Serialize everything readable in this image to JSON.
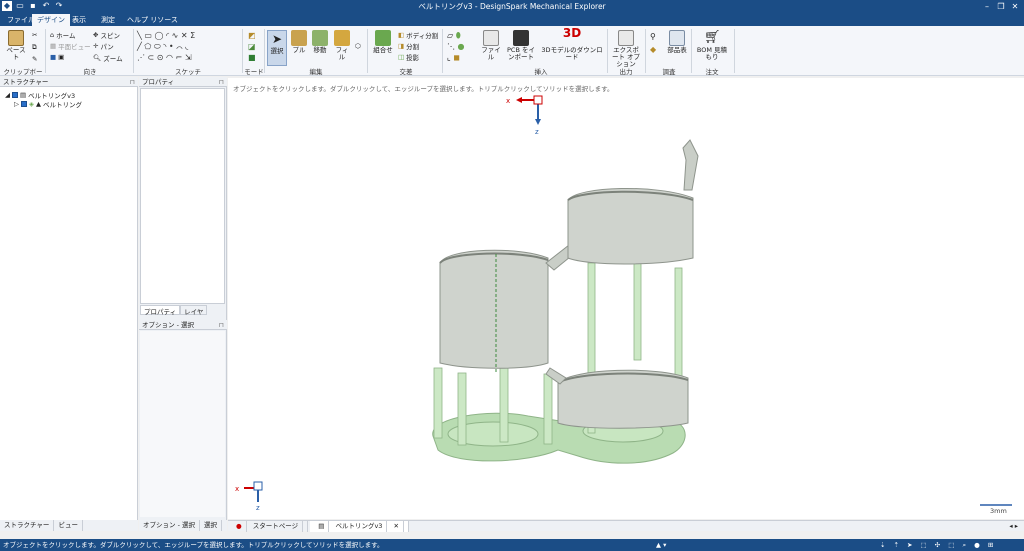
{
  "app": {
    "title": "ベルトリングv3 - DesignSpark Mechanical Explorer"
  },
  "menu": {
    "tabs": [
      "ファイル",
      "デザイン",
      "表示",
      "測定",
      "ヘルプ リソース"
    ],
    "active_index": 1
  },
  "ribbon": {
    "clipboard": {
      "paste": "ペースト",
      "label": "クリップボード"
    },
    "orient": {
      "home": "ホーム",
      "plane_view": "平面ビュー",
      "zoom": "ズーム",
      "spin": "スピン",
      "pan": "パン",
      "label": "向き"
    },
    "sketch": {
      "label": "スケッチ"
    },
    "mode": {
      "label": "モード"
    },
    "edit": {
      "select": "選択",
      "pull": "プル",
      "move": "移動",
      "fill": "フィル",
      "label": "編集"
    },
    "intersect": {
      "combine": "組合せ",
      "split_body": "ボディ分割",
      "split": "分割",
      "project": "投影",
      "label": "交差"
    },
    "insert": {
      "file": "ファイル",
      "pcb": "PCB をインポート",
      "download": "3Dモデルのダウンロード",
      "download_badge": "3D",
      "label": "挿入"
    },
    "output": {
      "export": "エクスポート オプション",
      "label": "出力"
    },
    "inspect": {
      "parts": "部品表",
      "label": "調査"
    },
    "order": {
      "bom": "BOM 見積もり",
      "label": "注文"
    }
  },
  "structure_panel": {
    "header": "ストラクチャー",
    "items": [
      {
        "label": "ベルトリングv3"
      },
      {
        "label": "ベルトリング"
      }
    ]
  },
  "properties_panel": {
    "header": "プロパティ",
    "tabs": [
      "プロパティ",
      "レイヤ"
    ]
  },
  "options_panel": {
    "header": "オプション - 選択"
  },
  "viewport": {
    "hint": "オブジェクトをクリックします。ダブルクリックして、エッジループを選択します。トリプルクリックしてソリッドを選択します。",
    "axis_x": "x",
    "axis_z": "z",
    "scale": "3mm"
  },
  "bottom_tabs_left": [
    "ストラクチャー",
    "ビュー"
  ],
  "bottom_tabs_mid": [
    "オプション - 選択",
    "選択"
  ],
  "doc_tabs": [
    "スタートページ",
    "ベルトリングv3"
  ],
  "status": {
    "text": "オブジェクトをクリックします。ダブルクリックして、エッジループを選択します。トリプルクリックしてソリッドを選択します。"
  },
  "colors": {
    "chrome": "#1b4d86",
    "model_gray": "#c9cec7",
    "model_green": "#b9dcb2"
  }
}
